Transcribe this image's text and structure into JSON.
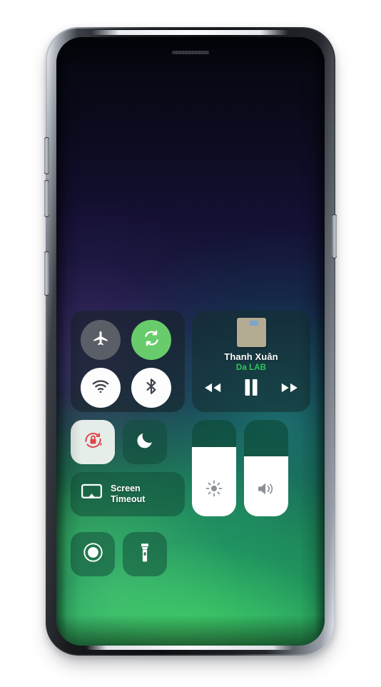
{
  "device": {
    "name": "samsung-galaxy-phone-mockup",
    "earpiece": "earpiece-speaker",
    "buttons": {
      "volume_up": "volume-up-button",
      "volume_down": "volume-down-button",
      "bixby": "bixby-button",
      "power": "power-button"
    }
  },
  "wallpaper": {
    "description": "dark navy to green gradient wallpaper",
    "top_color": "#05070e",
    "mid_color": "#161a3e",
    "bottom_color": "#2f9e4b"
  },
  "control_center": {
    "connectivity": {
      "toggles": [
        {
          "name": "airplane-mode",
          "icon": "airplane-icon",
          "state": "off",
          "bg": "#5a5e66",
          "fg": "#ffffff"
        },
        {
          "name": "mobile-data",
          "icon": "sync-arrows-icon",
          "state": "on",
          "bg": "#69cc6c",
          "fg": "#ffffff"
        },
        {
          "name": "wifi",
          "icon": "wifi-icon",
          "state": "on",
          "bg": "#fdfdfd",
          "fg": "#3a3f46"
        },
        {
          "name": "bluetooth",
          "icon": "bluetooth-icon",
          "state": "on",
          "bg": "#fdfdfd",
          "fg": "#3a3f46"
        }
      ]
    },
    "media": {
      "album_art": "album-artwork",
      "title": "Thanh Xuân",
      "artist": "Da LAB",
      "artist_color": "#2fc55a",
      "controls": [
        {
          "name": "rewind-button",
          "icon": "rewind-icon"
        },
        {
          "name": "pause-button",
          "icon": "pause-icon"
        },
        {
          "name": "forward-button",
          "icon": "fast-forward-icon"
        }
      ]
    },
    "tiles": [
      {
        "name": "rotation-lock",
        "icon": "rotation-lock-icon",
        "state": "on",
        "style": "light",
        "accent": "#e0434a"
      },
      {
        "name": "night-mode",
        "icon": "crescent-moon-icon",
        "state": "off",
        "style": "frost"
      },
      {
        "name": "screen-record",
        "icon": "record-circle-icon",
        "state": "off",
        "style": "frost"
      },
      {
        "name": "flashlight",
        "icon": "flashlight-icon",
        "state": "off",
        "style": "frost"
      }
    ],
    "screen_timeout": {
      "icon": "screen-mirror-icon",
      "label_line1": "Screen",
      "label_line2": "Timeout"
    },
    "sliders": [
      {
        "name": "brightness-slider",
        "icon": "brightness-sun-icon",
        "value": 72,
        "unit": "%"
      },
      {
        "name": "volume-slider",
        "icon": "volume-speaker-icon",
        "value": 62,
        "unit": "%"
      }
    ]
  }
}
